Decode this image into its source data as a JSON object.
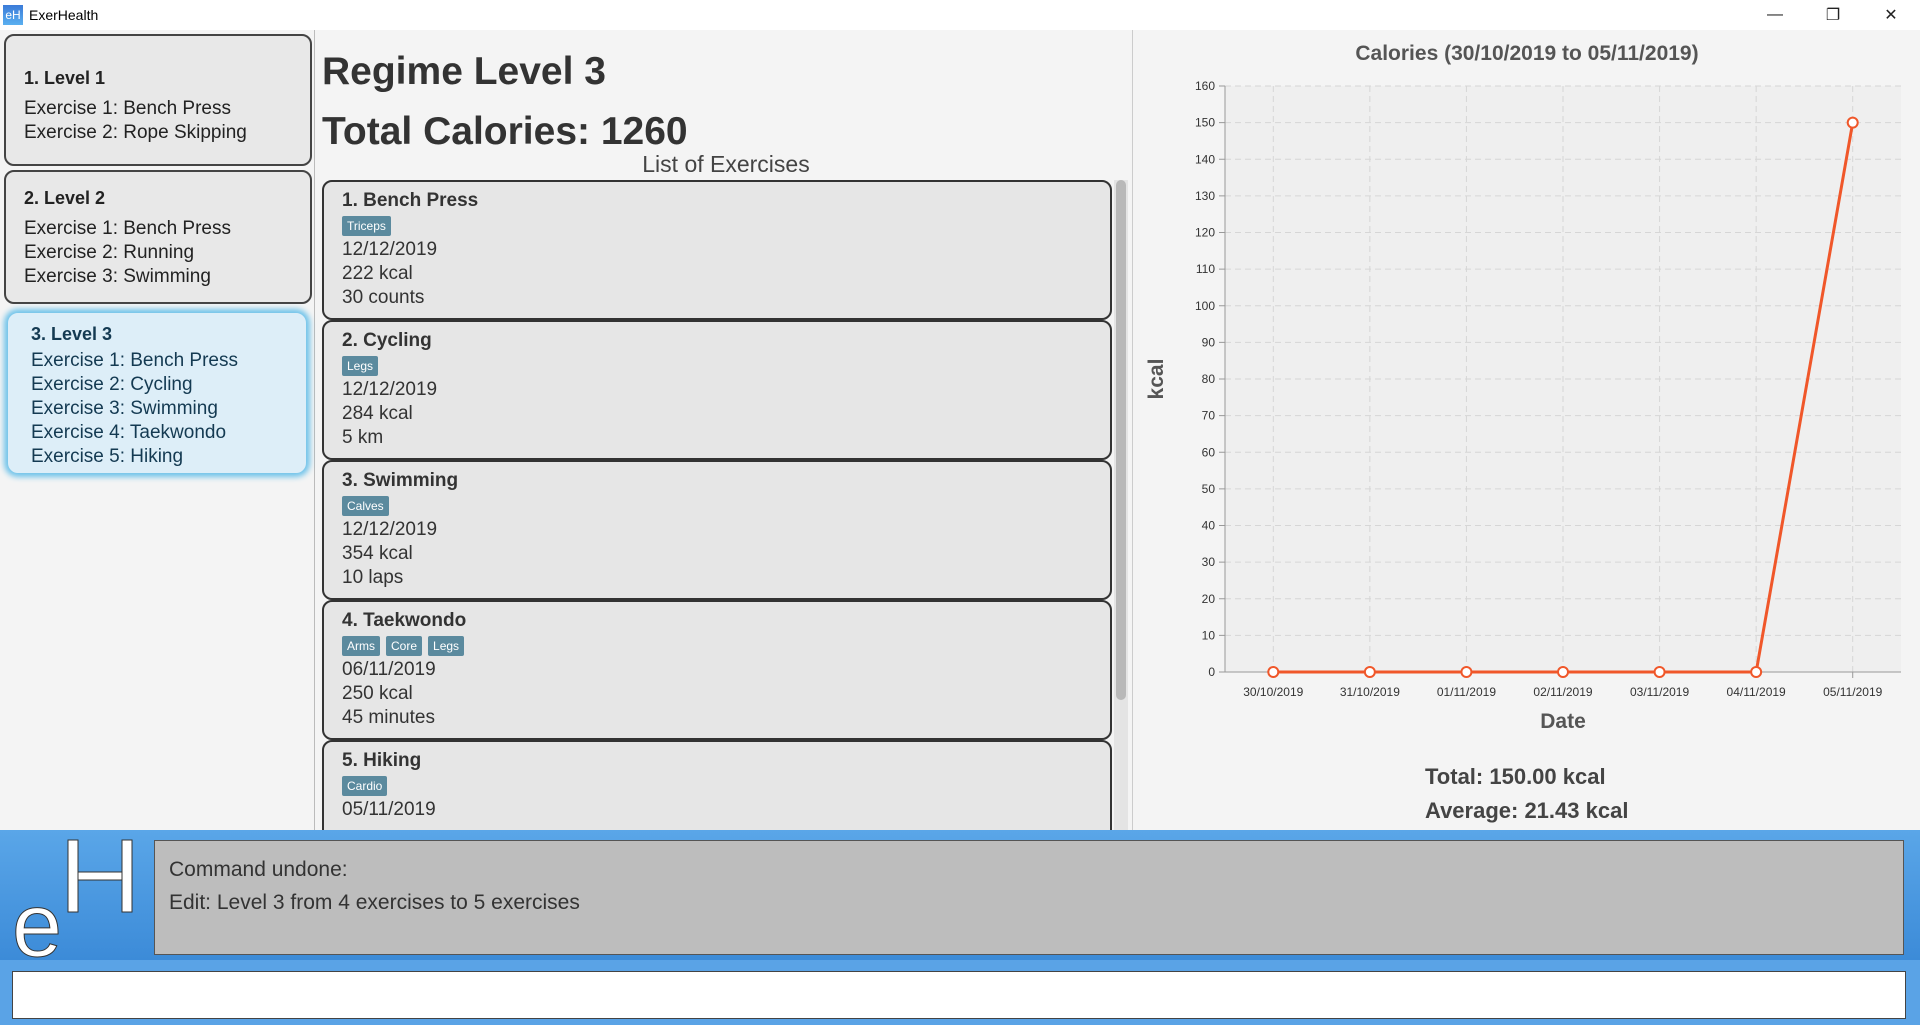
{
  "window": {
    "title": "ExerHealth",
    "icon_label": "eH"
  },
  "regimes": [
    {
      "title": "1.  Level 1",
      "exercises": [
        "Exercise 1: Bench Press",
        "Exercise 2: Rope Skipping"
      ]
    },
    {
      "title": "2.  Level 2",
      "exercises": [
        "Exercise 1: Bench Press",
        "Exercise 2: Running",
        "Exercise 3: Swimming"
      ]
    },
    {
      "title": "3.  Level 3",
      "exercises": [
        "Exercise 1: Bench Press",
        "Exercise 2: Cycling",
        "Exercise 3: Swimming",
        "Exercise 4: Taekwondo",
        "Exercise 5: Hiking"
      ]
    }
  ],
  "main": {
    "heading": "Regime Level 3",
    "total_calories": "Total Calories: 1260",
    "list_title": "List of Exercises"
  },
  "exercises": [
    {
      "name": "1.  Bench Press",
      "tags": [
        "Triceps"
      ],
      "date": "12/12/2019",
      "calories": "222 kcal",
      "quantity": "30 counts"
    },
    {
      "name": "2.  Cycling",
      "tags": [
        "Legs"
      ],
      "date": "12/12/2019",
      "calories": "284 kcal",
      "quantity": "5 km"
    },
    {
      "name": "3.  Swimming",
      "tags": [
        "Calves"
      ],
      "date": "12/12/2019",
      "calories": "354 kcal",
      "quantity": "10 laps"
    },
    {
      "name": "4.  Taekwondo",
      "tags": [
        "Arms",
        "Core",
        "Legs"
      ],
      "date": "06/11/2019",
      "calories": "250 kcal",
      "quantity": "45 minutes"
    },
    {
      "name": "5.  Hiking",
      "tags": [
        "Cardio"
      ],
      "date": "05/11/2019",
      "calories": "",
      "quantity": ""
    }
  ],
  "chart_data": {
    "type": "line",
    "title": "Calories (30/10/2019 to 05/11/2019)",
    "xlabel": "Date",
    "ylabel": "kcal",
    "categories": [
      "30/10/2019",
      "31/10/2019",
      "01/11/2019",
      "02/11/2019",
      "03/11/2019",
      "04/11/2019",
      "05/11/2019"
    ],
    "values": [
      0,
      0,
      0,
      0,
      0,
      0,
      150
    ],
    "ylim": [
      0,
      160
    ],
    "yticks": [
      0,
      10,
      20,
      30,
      40,
      50,
      60,
      70,
      80,
      90,
      100,
      110,
      120,
      130,
      140,
      150,
      160
    ],
    "grid": true,
    "line_color": "#f0572a"
  },
  "summary": {
    "total": "Total: 150.00 kcal",
    "average": "Average: 21.43 kcal"
  },
  "result_display": {
    "lines": [
      "Command undone:",
      "Edit: Level 3 from 4 exercises to 5 exercises"
    ]
  },
  "command_box": {
    "value": ""
  }
}
